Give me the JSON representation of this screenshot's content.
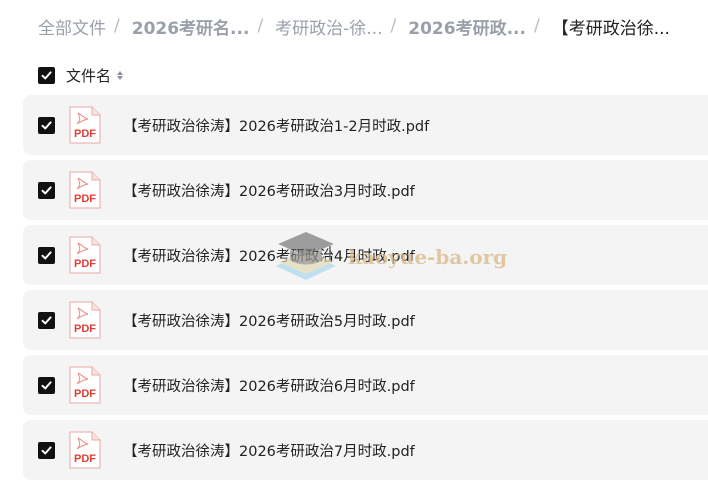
{
  "breadcrumb": {
    "items": [
      {
        "label": "全部文件"
      },
      {
        "label": "2026考研名..."
      },
      {
        "label": "考研政治-徐..."
      },
      {
        "label": "2026考研政..."
      },
      {
        "label": "【考研政治徐..."
      }
    ],
    "separator": "/"
  },
  "list_header": {
    "column_label": "文件名",
    "select_all_checked": true
  },
  "files": [
    {
      "name": "【考研政治徐涛】2026考研政治1-2月时政.pdf",
      "icon": "pdf-icon",
      "icon_label": "PDF",
      "checked": true
    },
    {
      "name": "【考研政治徐涛】2026考研政治3月时政.pdf",
      "icon": "pdf-icon",
      "icon_label": "PDF",
      "checked": true
    },
    {
      "name": "【考研政治徐涛】2026考研政治4月时政.pdf",
      "icon": "pdf-icon",
      "icon_label": "PDF",
      "checked": true
    },
    {
      "name": "【考研政治徐涛】2026考研政治5月时政.pdf",
      "icon": "pdf-icon",
      "icon_label": "PDF",
      "checked": true
    },
    {
      "name": "【考研政治徐涛】2026考研政治6月时政.pdf",
      "icon": "pdf-icon",
      "icon_label": "PDF",
      "checked": true
    },
    {
      "name": "【考研政治徐涛】2026考研政治7月时政.pdf",
      "icon": "pdf-icon",
      "icon_label": "PDF",
      "checked": true
    }
  ],
  "watermark": {
    "text": "kaoyue-ba.org",
    "icon": "graduation-cap-icon"
  },
  "colors": {
    "row_background": "#f4f4f5",
    "pdf_red": "#e03e36",
    "checkbox": "#111111",
    "breadcrumb_muted": "#9aa0aa"
  }
}
